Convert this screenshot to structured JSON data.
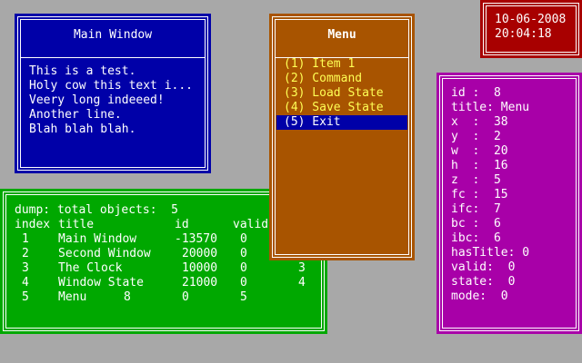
{
  "main_window": {
    "title": "Main Window",
    "lines": [
      "This is a test.",
      "Holy cow this text i...",
      "Veery long indeeed!",
      "Another line.",
      "Blah blah blah."
    ]
  },
  "menu": {
    "title": "Menu",
    "items": [
      "(1) Item 1",
      "(2) Command",
      "(3) Load State",
      "(4) Save State",
      "(5) Exit"
    ],
    "selected_index": 4
  },
  "clock": {
    "date": "10-06-2008",
    "time": "20:04:18"
  },
  "info": {
    "lines": [
      "id :  8",
      "title: Menu",
      "x  :  38",
      "y  :  2",
      "w  :  20",
      "h  :  16",
      "z  :  5",
      "fc :  15",
      "ifc:  7",
      "bc :  6",
      "ibc:  6",
      "hasTitle: 0",
      "valid:  0",
      "state:  0",
      "mode:  0"
    ]
  },
  "dump": {
    "summary": "dump: total objects:  5",
    "header": {
      "index": "index",
      "title": "title",
      "id": "id",
      "valid": "valid"
    },
    "rows": [
      {
        "index": "1",
        "title": "Main Window",
        "id": "-13570",
        "valid": "0",
        "state": ""
      },
      {
        "index": "2",
        "title": "Second Window",
        "id": "20000",
        "valid": "0",
        "state": ""
      },
      {
        "index": "3",
        "title": "The Clock",
        "id": "10000",
        "valid": "0",
        "state": "3"
      },
      {
        "index": "4",
        "title": "Window State",
        "id": "21000",
        "valid": "0",
        "state": "4"
      },
      {
        "index": "5",
        "title": "Menu",
        "id": "8",
        "valid": "0",
        "state": "5"
      }
    ]
  },
  "colors": {
    "desktop": "#a8a8a8",
    "main_bg": "#0000a8",
    "menu_bg": "#a85400",
    "menu_text": "#ffff54",
    "menu_highlight": "#0000a8",
    "clock_bg": "#a80000",
    "info_bg": "#a800a8",
    "dump_bg": "#00a800",
    "border": "#ffffff"
  }
}
